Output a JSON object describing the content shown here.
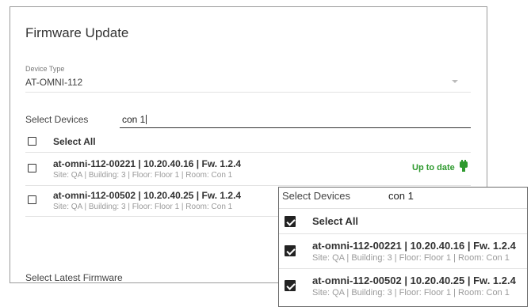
{
  "page": {
    "title": "Firmware Update",
    "device_type": {
      "label": "Device Type",
      "value": "AT-OMNI-112"
    },
    "select_devices": {
      "label": "Select Devices",
      "search_value": "con 1"
    },
    "select_all_label": "Select All",
    "devices": [
      {
        "name": "at-omni-112-00221 | 10.20.40.16 | Fw. 1.2.4",
        "location": "Site: QA | Building: 3 | Floor: Floor 1 | Room: Con 1",
        "status": "Up to date",
        "checked": false
      },
      {
        "name": "at-omni-112-00502 | 10.20.40.25 | Fw. 1.2.4",
        "location": "Site: QA | Building: 3 | Floor: Floor 1 | Room: Con 1",
        "checked": false
      }
    ],
    "latest_firmware_label": "Select Latest Firmware"
  },
  "zoom": {
    "select_devices": {
      "label": "Select Devices",
      "search_value": "con 1"
    },
    "select_all_label": "Select All",
    "select_all_checked": true,
    "devices": [
      {
        "name": "at-omni-112-00221 | 10.20.40.16 | Fw. 1.2.4",
        "location": "Site: QA | Building: 3 | Floor: Floor 1 | Room: Con 1",
        "checked": true
      },
      {
        "name": "at-omni-112-00502 | 10.20.40.25 | Fw. 1.2.4",
        "location": "Site: QA | Building: 3 | Floor: Floor 1 | Room: Con 1",
        "checked": true
      }
    ]
  },
  "colors": {
    "status_green": "#2e9a2e",
    "checkbox_dark": "#222222",
    "divider": "#e2e2e2"
  },
  "icons": {
    "status": "plug-icon",
    "dropdown": "caret-down-icon",
    "check": "checkmark-icon"
  }
}
